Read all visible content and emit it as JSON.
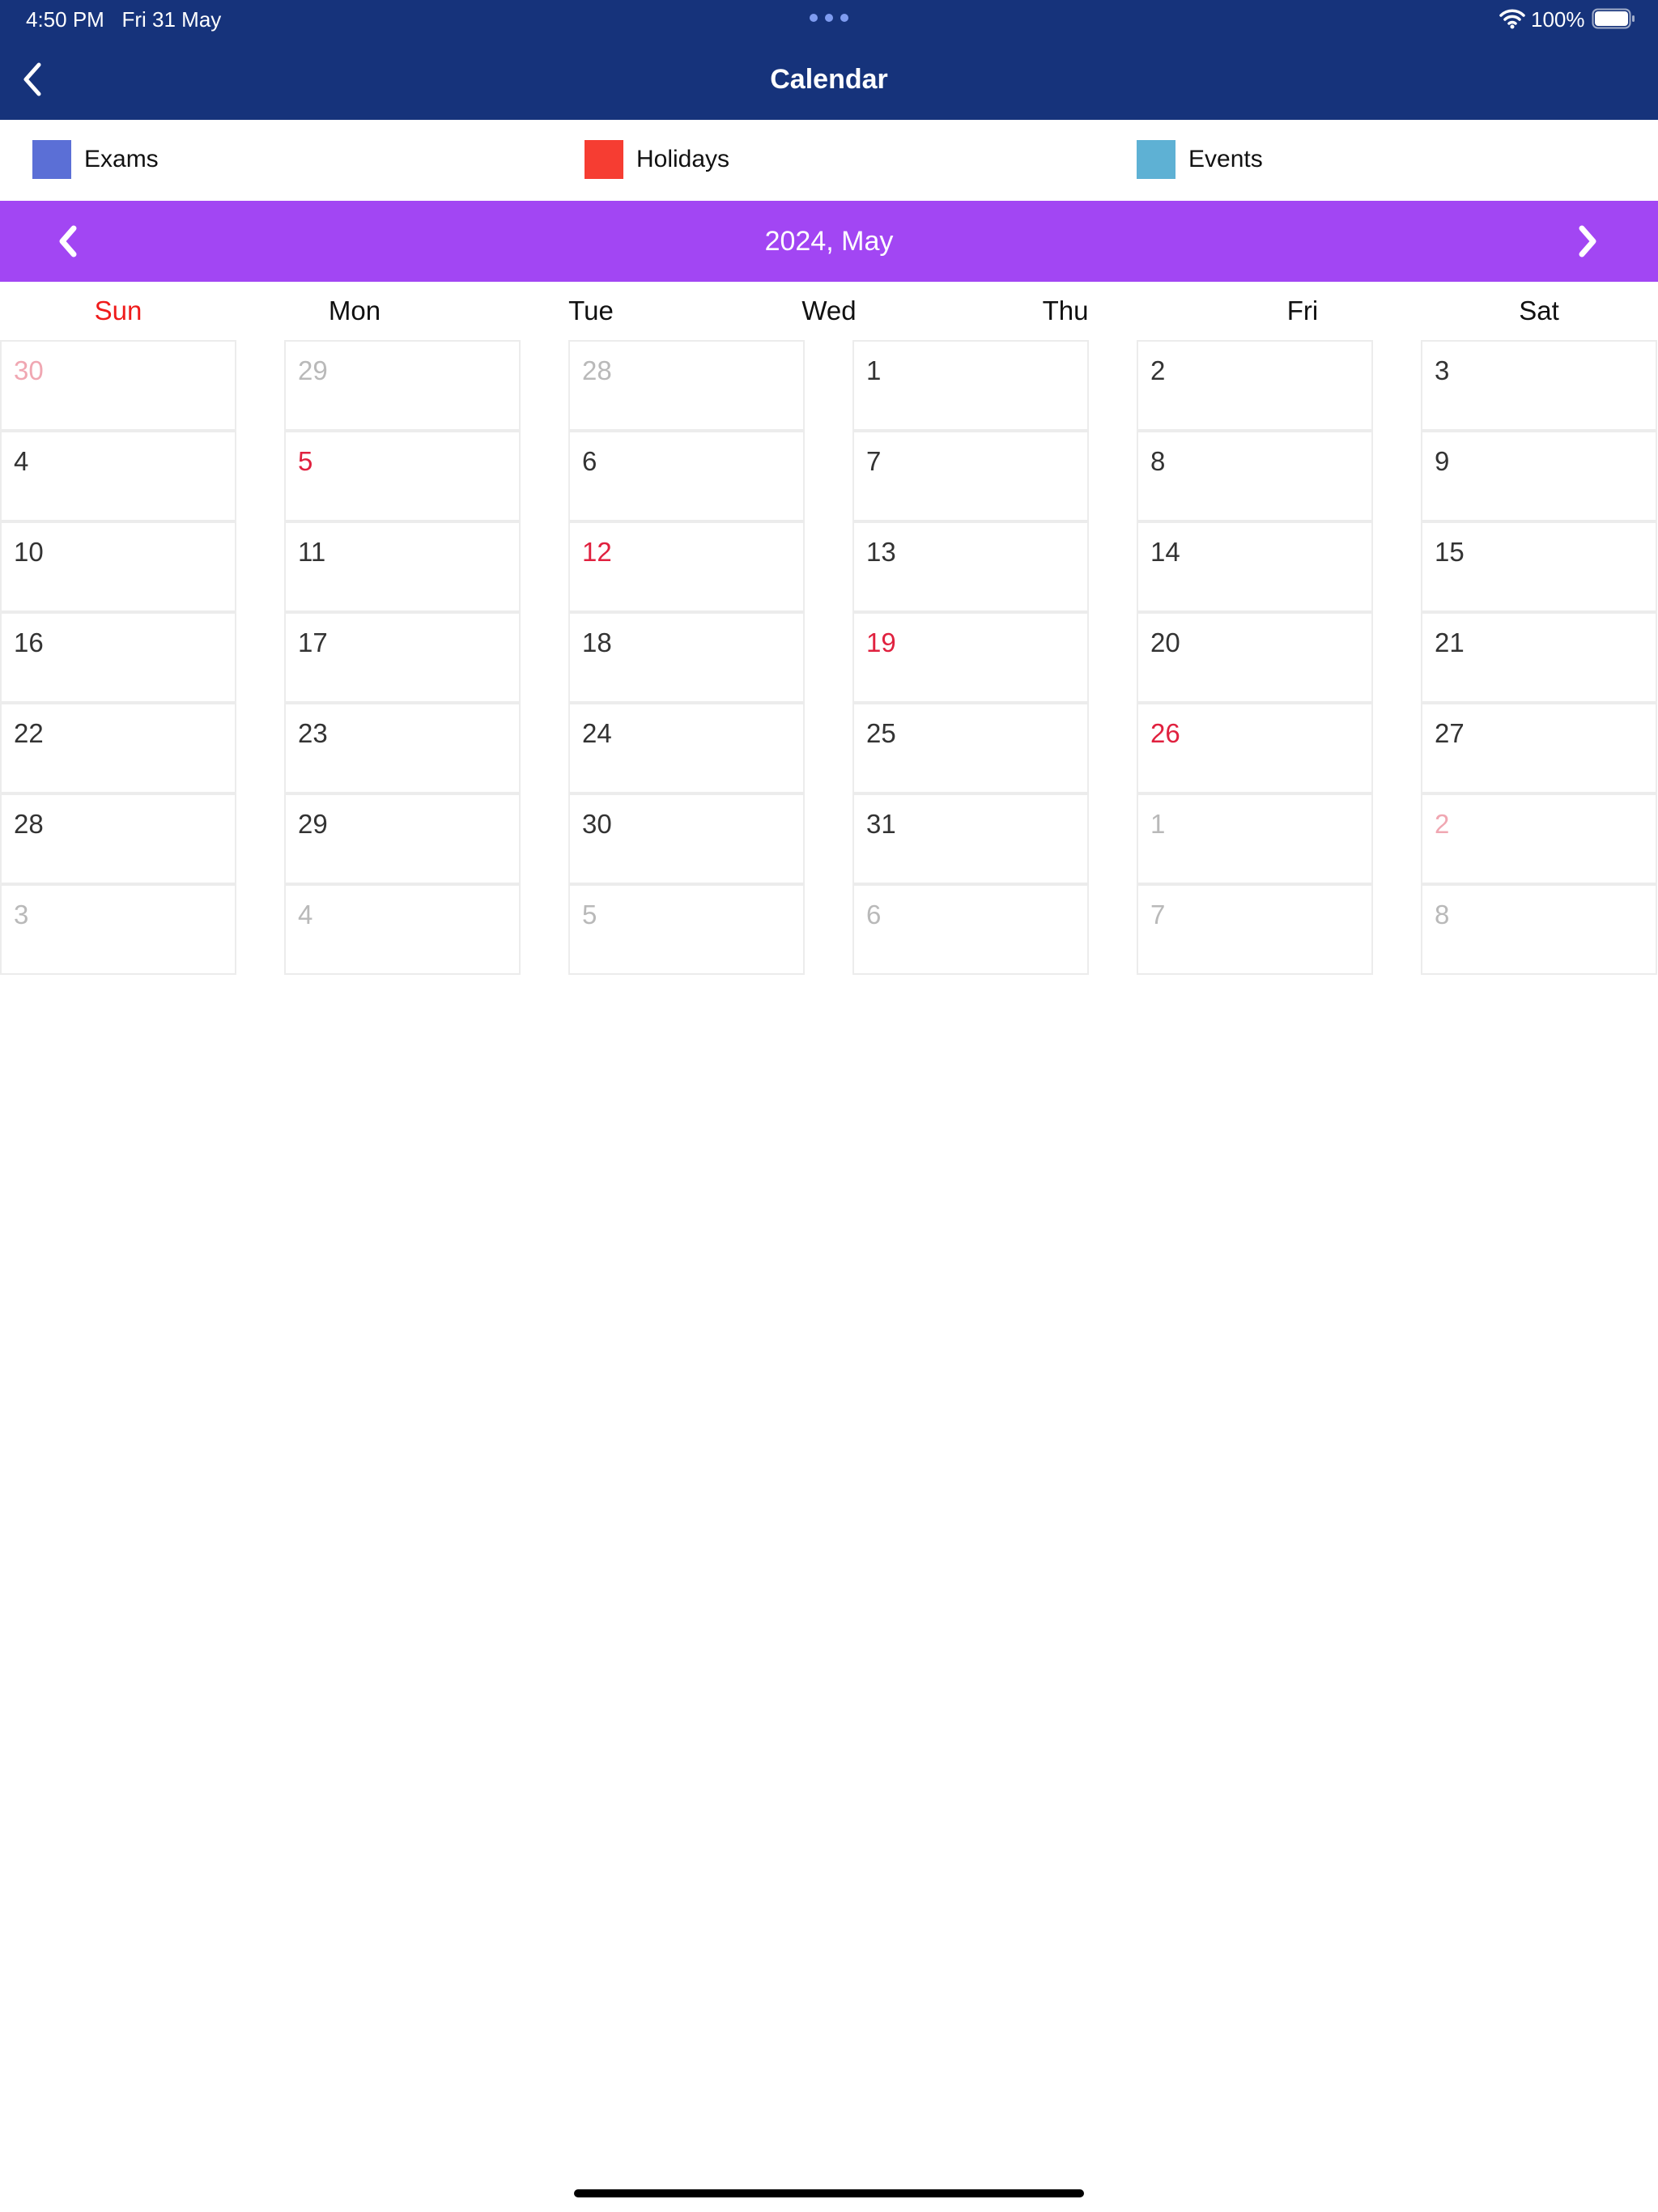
{
  "status_bar": {
    "time_date": "4:50 PM   Fri 31 May",
    "battery_percent": "100%",
    "battery_level": 1.0,
    "icons": [
      "more-dots-icon",
      "wifi-icon",
      "battery-icon"
    ]
  },
  "nav": {
    "title": "Calendar",
    "back_icon": "chevron-left-icon"
  },
  "legend": [
    {
      "label": "Exams",
      "color": "#5b6fd6"
    },
    {
      "label": "Holidays",
      "color": "#f63d32"
    },
    {
      "label": "Events",
      "color": "#5eb1d4"
    }
  ],
  "month_header": {
    "title": "2024, May",
    "prev_icon": "chevron-left-icon",
    "next_icon": "chevron-right-icon",
    "background": "#a246f3"
  },
  "weekdays": [
    "Sun",
    "Mon",
    "Tue",
    "Wed",
    "Thu",
    "Fri",
    "Sat"
  ],
  "weeks": [
    [
      {
        "day": "30",
        "state": "other-holiday"
      },
      {
        "day": "29",
        "state": "other"
      },
      {
        "day": "28",
        "state": "other"
      },
      {
        "day": "1",
        "state": "normal"
      },
      {
        "day": "2",
        "state": "normal"
      },
      {
        "day": "3",
        "state": "normal"
      }
    ],
    [
      {
        "day": "4",
        "state": "normal"
      },
      {
        "day": "5",
        "state": "holiday"
      },
      {
        "day": "6",
        "state": "normal"
      },
      {
        "day": "7",
        "state": "normal"
      },
      {
        "day": "8",
        "state": "normal"
      },
      {
        "day": "9",
        "state": "normal"
      }
    ],
    [
      {
        "day": "10",
        "state": "normal"
      },
      {
        "day": "11",
        "state": "normal"
      },
      {
        "day": "12",
        "state": "holiday"
      },
      {
        "day": "13",
        "state": "normal"
      },
      {
        "day": "14",
        "state": "normal"
      },
      {
        "day": "15",
        "state": "normal"
      }
    ],
    [
      {
        "day": "16",
        "state": "normal"
      },
      {
        "day": "17",
        "state": "normal"
      },
      {
        "day": "18",
        "state": "normal"
      },
      {
        "day": "19",
        "state": "holiday"
      },
      {
        "day": "20",
        "state": "normal"
      },
      {
        "day": "21",
        "state": "normal"
      }
    ],
    [
      {
        "day": "22",
        "state": "normal"
      },
      {
        "day": "23",
        "state": "normal"
      },
      {
        "day": "24",
        "state": "normal"
      },
      {
        "day": "25",
        "state": "normal"
      },
      {
        "day": "26",
        "state": "holiday"
      },
      {
        "day": "27",
        "state": "normal"
      }
    ],
    [
      {
        "day": "28",
        "state": "normal"
      },
      {
        "day": "29",
        "state": "normal"
      },
      {
        "day": "30",
        "state": "normal"
      },
      {
        "day": "31",
        "state": "normal"
      },
      {
        "day": "1",
        "state": "other"
      },
      {
        "day": "2",
        "state": "other-holiday"
      }
    ],
    [
      {
        "day": "3",
        "state": "other"
      },
      {
        "day": "4",
        "state": "other"
      },
      {
        "day": "5",
        "state": "other"
      },
      {
        "day": "6",
        "state": "other"
      },
      {
        "day": "7",
        "state": "other"
      },
      {
        "day": "8",
        "state": "other"
      }
    ]
  ]
}
